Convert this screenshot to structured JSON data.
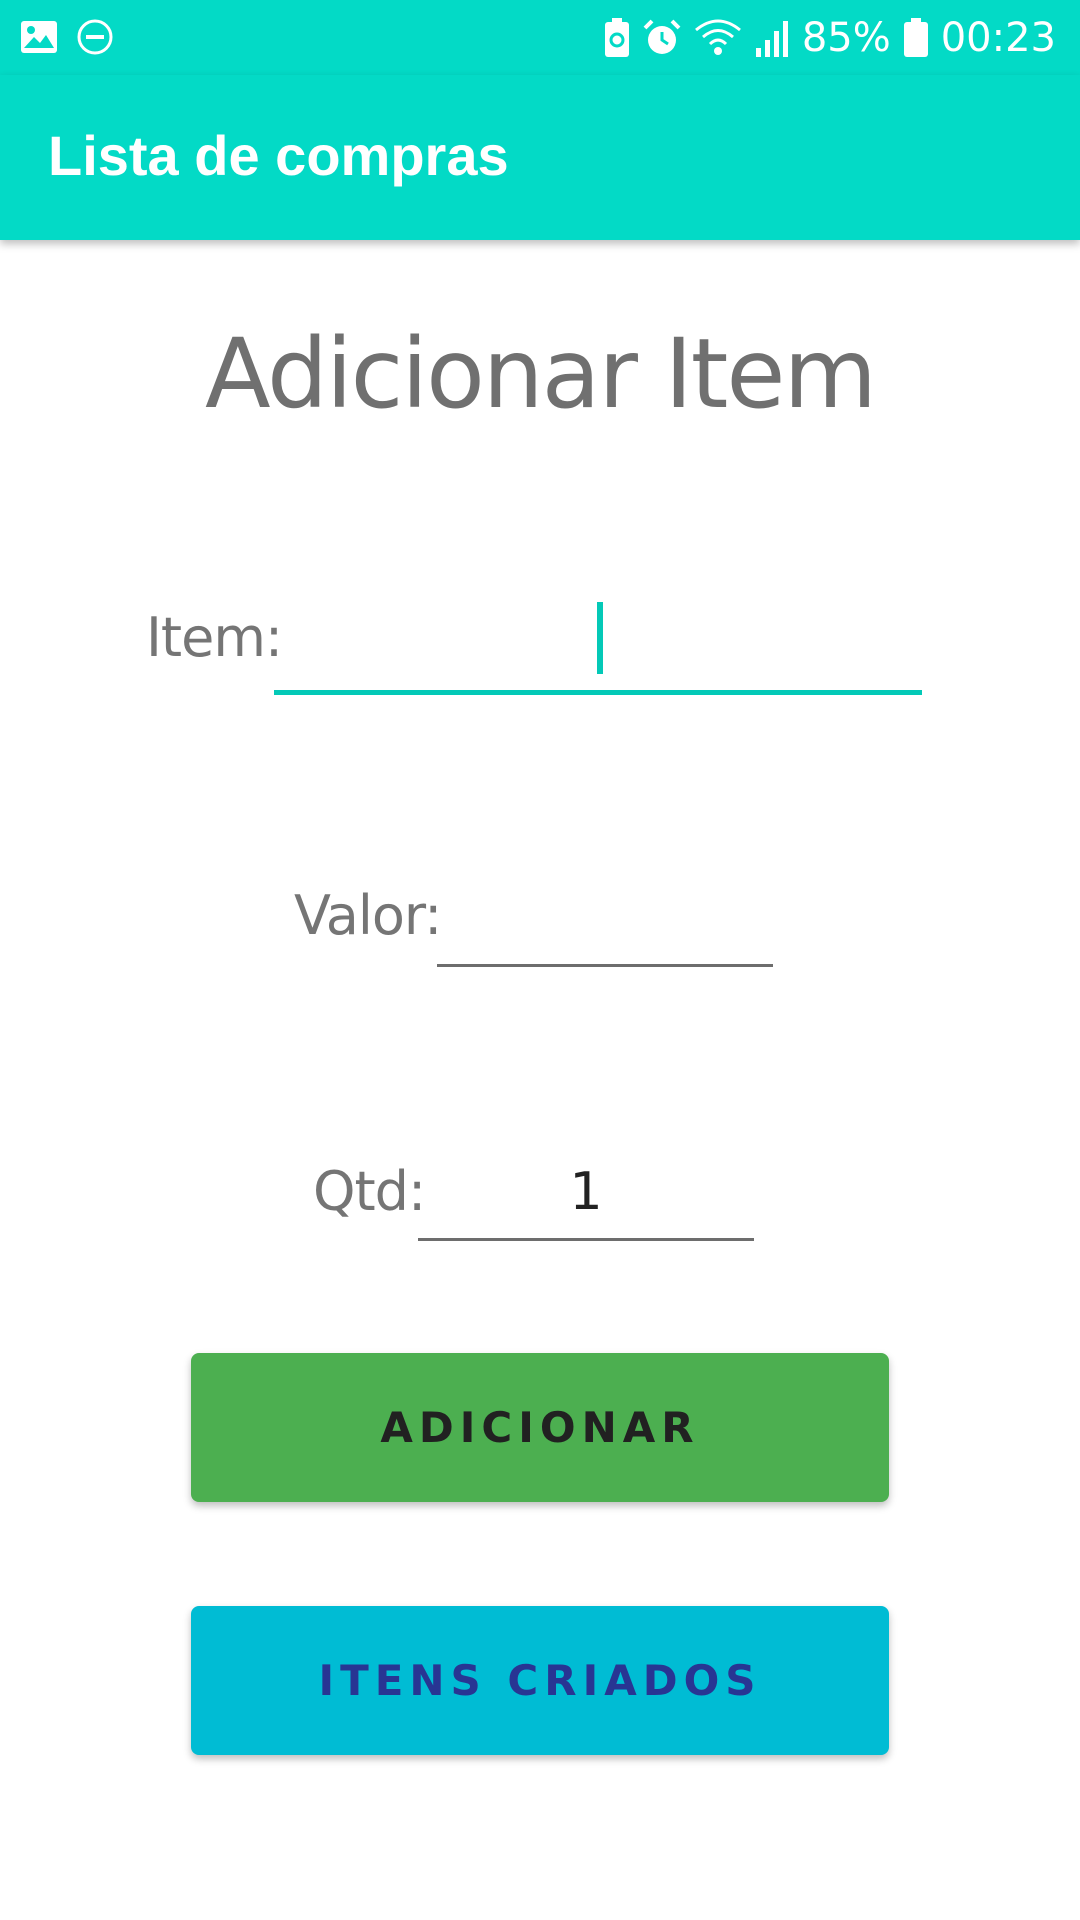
{
  "status_bar": {
    "icons_left": [
      "image-icon",
      "do-not-disturb-icon"
    ],
    "icons_right": [
      "battery-saver-icon",
      "alarm-icon",
      "wifi-icon",
      "signal-icon"
    ],
    "battery_percent": "85%",
    "time": "00:23",
    "color": "#03dac6"
  },
  "app_bar": {
    "title": "Lista de compras",
    "color": "#03dac6"
  },
  "page": {
    "heading": "Adicionar Item"
  },
  "form": {
    "item_label": "Item:",
    "item_value": "",
    "valor_label": "Valor:",
    "valor_value": "",
    "qtd_label": "Qtd:",
    "qtd_value": "1",
    "accent_color": "#03c9b7"
  },
  "buttons": {
    "add_label": "ADICIONAR",
    "add_color": "#4caf50",
    "list_label": "ITENS CRIADOS",
    "list_color": "#00bcd4"
  }
}
